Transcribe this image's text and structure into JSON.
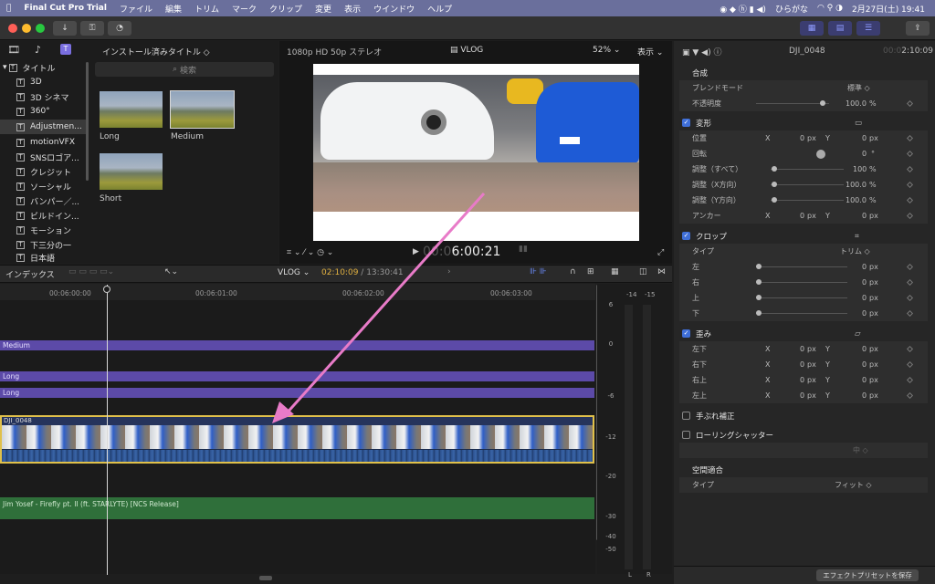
{
  "menubar": {
    "apple": "",
    "app": "Final Cut Pro Trial",
    "items": [
      "ファイル",
      "編集",
      "トリム",
      "マーク",
      "クリップ",
      "変更",
      "表示",
      "ウインドウ",
      "ヘルプ"
    ],
    "input_method": "ひらがな",
    "datetime": "2月27日(土)  19:41"
  },
  "browser": {
    "library_title": "インストール済みタイトル ◇",
    "search_placeholder": "検索",
    "sidebar": [
      "タイトル",
      "3D",
      "3D シネマ",
      "360°",
      "Adjustmen...",
      "motionVFX",
      "SNSロゴア...",
      "クレジット",
      "ソーシャル",
      "バンパー／...",
      "ビルドイン...",
      "モーション",
      "下三分の一",
      "日本語"
    ],
    "clips": [
      "Long",
      "Medium",
      "Short"
    ]
  },
  "viewer": {
    "format": "1080p HD 50p ステレオ",
    "project": "VLOG",
    "zoom": "52% ⌄",
    "view": "表示 ⌄",
    "timecode_dim": "00:0",
    "timecode": "6:00:21"
  },
  "timeline": {
    "index": "インデックス",
    "project": "VLOG ⌄",
    "position": "02:10:09",
    "duration": "/ 13:30:41",
    "ruler": [
      "00:06:00:00",
      "00:06:01:00",
      "00:06:02:00",
      "00:06:03:00"
    ],
    "titles": [
      "Medium",
      "Long",
      "Long"
    ],
    "video_clip": "DJI_0048",
    "audio_clip": "Jim Yosef - Firefly pt. II (ft. STARLYTE) [NCS Release]"
  },
  "meters": {
    "top": [
      "-14",
      "-15"
    ],
    "scale": [
      "6",
      "0",
      "-6",
      "-12",
      "-20",
      "-30",
      "-40",
      "-50"
    ],
    "channels": [
      "L",
      "R"
    ]
  },
  "inspector": {
    "clip": "DJI_0048",
    "duration": "2:10:09",
    "time_dim": "00:0",
    "composite": "合成",
    "blend_label": "ブレンドモード",
    "blend_value": "標準 ◇",
    "opacity_label": "不透明度",
    "opacity_value": "100.0",
    "pct": "%",
    "transform": "変形",
    "position": "位置",
    "x": "X",
    "y": "Y",
    "zero": "0",
    "px": "px",
    "rotation": "回転",
    "deg": "°",
    "scale_all": "調整（すべて）",
    "scale_all_v": "100",
    "scale_x": "調整（X方向）",
    "scale_x_v": "100.0",
    "scale_y": "調整（Y方向）",
    "scale_y_v": "100.0",
    "anchor": "アンカー",
    "crop": "クロップ",
    "type": "タイプ",
    "crop_type": "トリム ◇",
    "left": "左",
    "right": "右",
    "top": "上",
    "bottom": "下",
    "distort": "歪み",
    "bl": "左下",
    "br": "右下",
    "tr": "右上",
    "tl": "左上",
    "stab": "手ぶれ補正",
    "rolling": "ローリングシャッター",
    "rolling_val": "中 ◇",
    "spatial": "空間適合",
    "fit_type": "フィット ◇",
    "preset_button": "エフェクトプリセットを保存"
  }
}
